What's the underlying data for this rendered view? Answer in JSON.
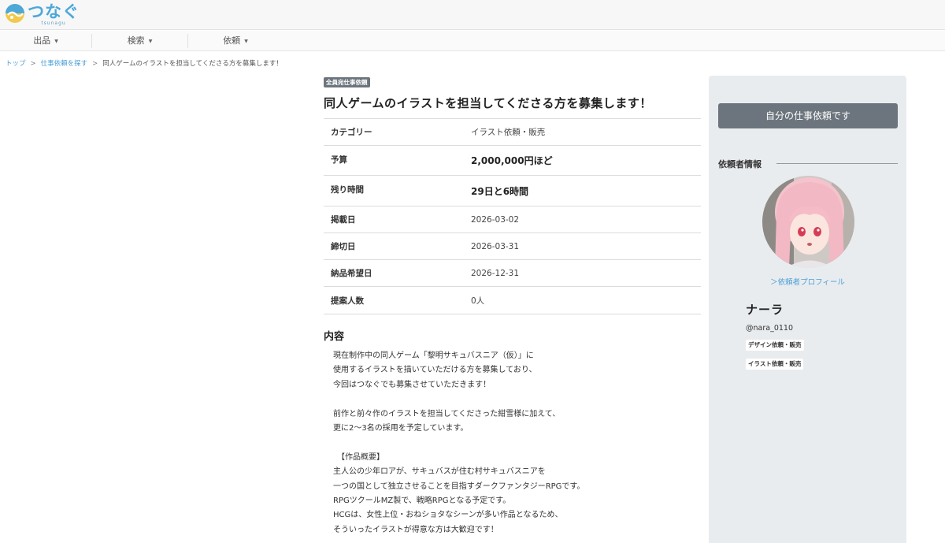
{
  "header": {
    "logo_text": "つなぐ",
    "logo_sub": "tsunagu",
    "nav": [
      {
        "label": "出品"
      },
      {
        "label": "検索"
      },
      {
        "label": "依頼"
      }
    ]
  },
  "breadcrumb": {
    "home": "トップ",
    "parent": "仕事依頼を探す",
    "current": "同人ゲームのイラストを担当してくださる方を募集します！",
    "separator": ">"
  },
  "job": {
    "badge": "全員宛仕事依頼",
    "title": "同人ゲームのイラストを担当してくださる方を募集します！",
    "details": [
      {
        "label": "カテゴリー",
        "value": "イラスト依頼・販売"
      },
      {
        "label": "予算",
        "value": "2,000,000円ほど"
      },
      {
        "label": "残り時間",
        "value": "29日と6時間"
      },
      {
        "label": "掲載日",
        "value": "2026-03-02"
      },
      {
        "label": "締切日",
        "value": "2026-03-31"
      },
      {
        "label": "納品希望日",
        "value": "2026-12-31"
      },
      {
        "label": "提案人数",
        "value": "0人"
      }
    ],
    "content_heading": "内容",
    "content_lines": [
      "現在制作中の同人ゲーム「黎明サキュバスニア（仮）」に",
      "使用するイラストを描いていただける方を募集しており、",
      "今回はつなぐでも募集させていただきます！",
      "",
      "前作と前々作のイラストを担当してくださった紺雪様に加えて、",
      "更に2〜3名の採用を予定しています。",
      "",
      "　【作品概要】",
      "主人公の少年ロアが、サキュバスが住む村サキュバスニアを",
      "一つの国として独立させることを目指すダークファンタジーRPGです。",
      "RPGツクールMZ製で、戦略RPGとなる予定です。",
      "HCGは、女性上位・おねショタなシーンが多い作品となるため、",
      "そういったイラストが得意な方は大歓迎です！"
    ]
  },
  "sidebar": {
    "own_request_button": "自分の仕事依頼です",
    "requester_heading": "依頼者情報",
    "profile_link": "＞依頼者プロフィール",
    "username": "ナーラ",
    "user_id": "@nara_0110",
    "tags": [
      "デザイン依頼・販売",
      "イラスト依頼・販売"
    ]
  },
  "colors": {
    "accent_blue": "#4a9fd5",
    "badge_gray": "#6c757d",
    "sidebar_bg": "#e9ecef"
  }
}
